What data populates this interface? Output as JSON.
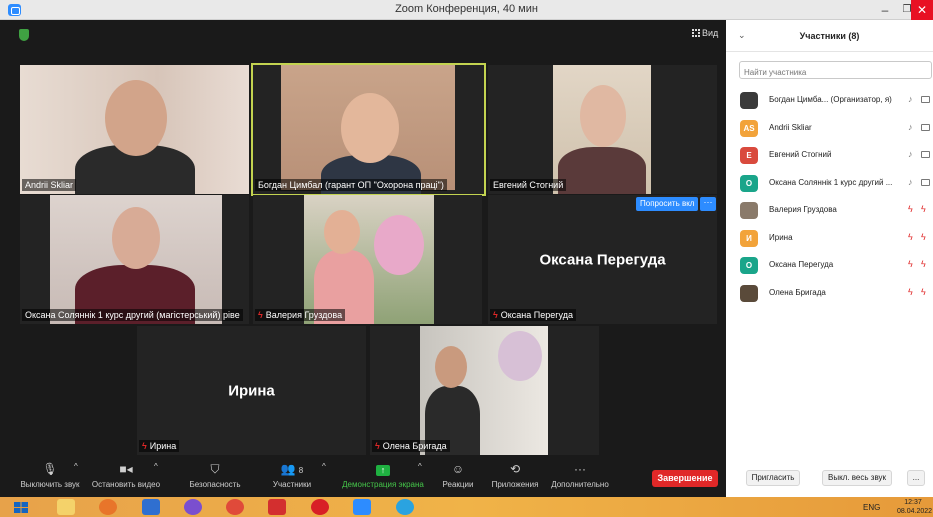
{
  "window": {
    "title": "Zoom Конференция, 40 мин",
    "minimize": "–",
    "maximize": "❐",
    "close": "✕"
  },
  "meeting": {
    "view_label": "Вид",
    "tiles": [
      {
        "name": "Andrii Skliar",
        "muted": false
      },
      {
        "name": "Богдан Цимбал (гарант ОП \"Охорона праці\")",
        "muted": false,
        "active": true
      },
      {
        "name": "Евгений Стогний",
        "muted": false
      },
      {
        "name": "Оксана Соляннік 1 курс другий (магістерський) рівe",
        "muted": false
      },
      {
        "name": "Валерия Груздова",
        "muted": true
      },
      {
        "name": "Оксана Перегуда",
        "muted": true,
        "display_name": "Оксана Перегуда",
        "ask_button": "Попросить вкл",
        "more_button": "···"
      },
      {
        "name": "Ирина",
        "muted": true,
        "display_name": "Ирина"
      },
      {
        "name": "Олена Бригада",
        "muted": true
      }
    ]
  },
  "toolbar": {
    "mute": "Выключить звук",
    "video": "Остановить видео",
    "security": "Безопасность",
    "participants": "Участники",
    "participants_count": "8",
    "share": "Демонстрация экрана",
    "reactions": "Реакции",
    "apps": "Приложения",
    "more": "Дополнительно",
    "end": "Завершение"
  },
  "panel": {
    "title": "Участники (8)",
    "search_placeholder": "Найти участника",
    "participants": [
      {
        "name": "Богдан Цимба... (Организатор, я)",
        "initials": "",
        "color": "#3a3a3a",
        "muted": false
      },
      {
        "name": "Andrii Skliar",
        "initials": "AS",
        "color": "#f2a33a",
        "muted": false
      },
      {
        "name": "Евгений Стогний",
        "initials": "Е",
        "color": "#d94a3d",
        "muted": false
      },
      {
        "name": "Оксана Соляннік 1 курс другий ...",
        "initials": "О",
        "color": "#1aa58a",
        "muted": false
      },
      {
        "name": "Валерия Груздова",
        "initials": "",
        "color": "#8a7a6a",
        "muted": true
      },
      {
        "name": "Ирина",
        "initials": "И",
        "color": "#f2a33a",
        "muted": true
      },
      {
        "name": "Оксана Перегуда",
        "initials": "О",
        "color": "#1aa58a",
        "muted": true
      },
      {
        "name": "Олена Бригада",
        "initials": "",
        "color": "#5a4a3a",
        "muted": true
      }
    ],
    "invite": "Пригласить",
    "mute_all": "Выкл. весь звук",
    "more": "..."
  },
  "taskbar": {
    "lang": "ENG",
    "time": "12:37",
    "date": "08.04.2022"
  },
  "colors": {
    "accent": "#2d8cff",
    "danger": "#e02828",
    "active_speaker": "#c3d350"
  }
}
